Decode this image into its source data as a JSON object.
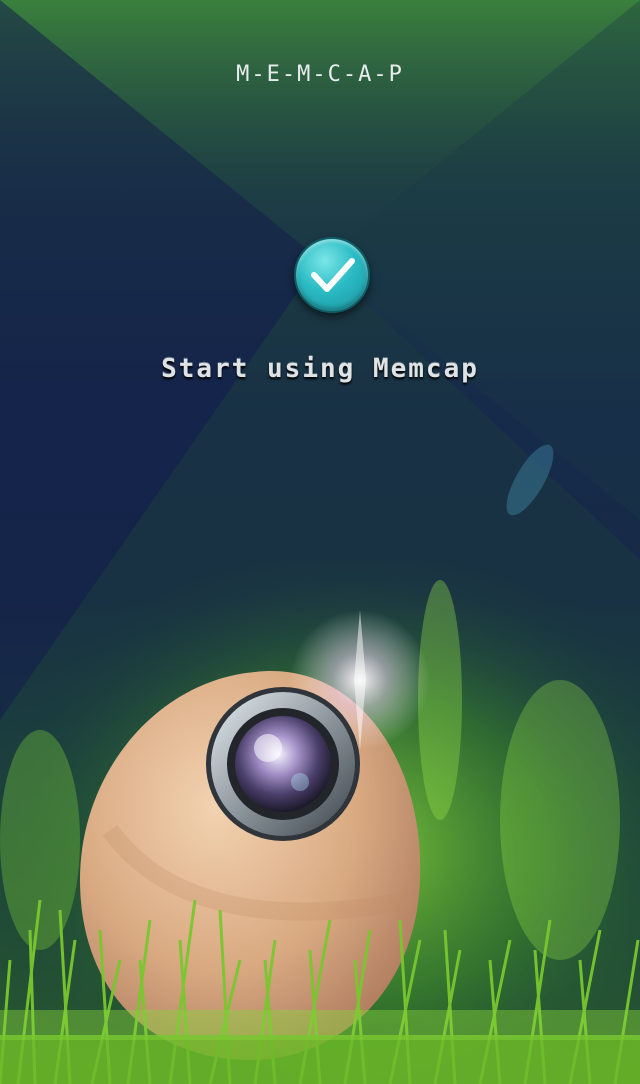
{
  "app": {
    "logo_text": "M-E-M-C-A-P"
  },
  "main": {
    "start_label": "Start using Memcap"
  },
  "icons": {
    "confirm": "check-circle-icon",
    "mascot": "egg-camera-icon"
  },
  "colors": {
    "accent": "#2bbbc4",
    "grass": "#6fc22a"
  }
}
